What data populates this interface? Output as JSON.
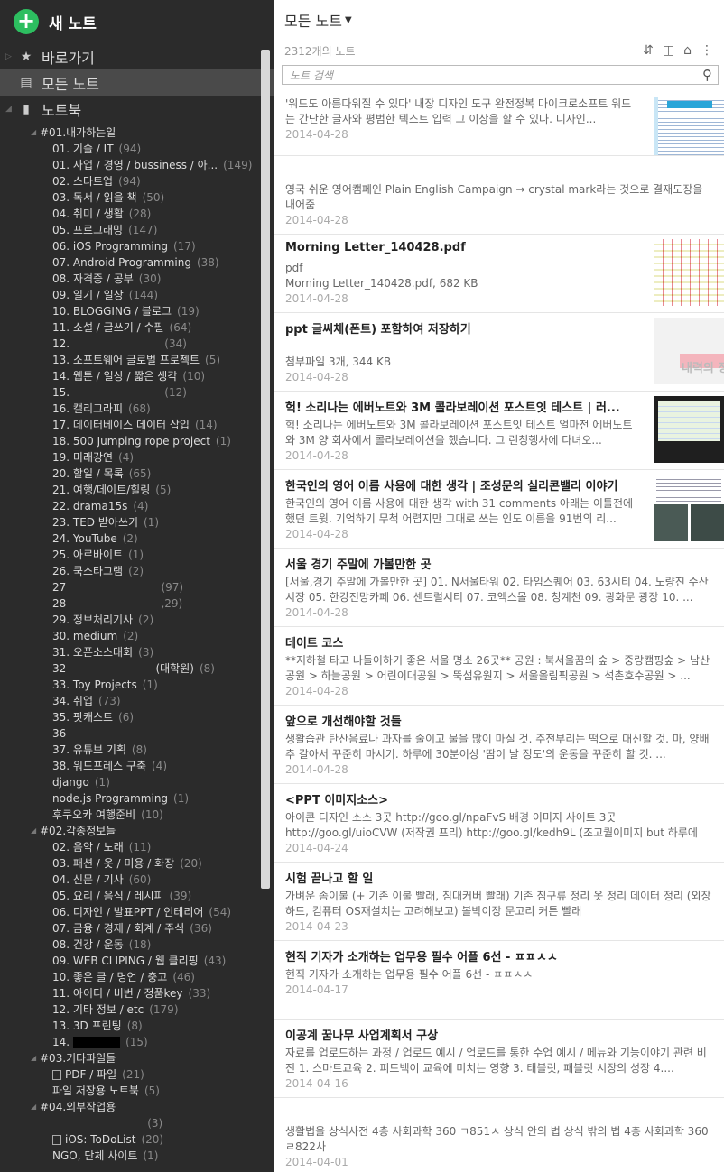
{
  "sidebar": {
    "new_note": "새 노트",
    "shortcuts": "바로가기",
    "all_notes": "모든 노트",
    "notebooks": "노트북",
    "tree": [
      {
        "kind": "stack",
        "label": "#01.내가하는일",
        "count": ""
      },
      {
        "kind": "nb",
        "label": "01. 기술 / IT",
        "count": "(94)"
      },
      {
        "kind": "nb",
        "label": "01. 사업 / 경영 / bussiness / 아...",
        "count": "(149)"
      },
      {
        "kind": "nb",
        "label": "02. 스타트업",
        "count": "(94)"
      },
      {
        "kind": "nb",
        "label": "03. 독서 / 읽을 책",
        "count": "(50)"
      },
      {
        "kind": "nb",
        "label": "04. 취미 / 생활",
        "count": "(28)"
      },
      {
        "kind": "nb",
        "label": "05. 프로그래밍",
        "count": "(147)"
      },
      {
        "kind": "nb",
        "label": "06. iOS Programming",
        "count": "(17)"
      },
      {
        "kind": "nb",
        "label": "07. Android Programming",
        "count": "(38)"
      },
      {
        "kind": "nb",
        "label": "08. 자격증 / 공부",
        "count": "(30)"
      },
      {
        "kind": "nb",
        "label": "09. 일기 / 일상",
        "count": "(144)"
      },
      {
        "kind": "nb",
        "label": "10. BLOGGING / 블로그",
        "count": "(19)"
      },
      {
        "kind": "nb",
        "label": "11. 소설 / 글쓰기 / 수필",
        "count": "(64)"
      },
      {
        "kind": "nb",
        "label": "12.                          ",
        "count": "(34)"
      },
      {
        "kind": "nb",
        "label": "13. 소프트웨어 글로벌 프로젝트",
        "count": "(5)"
      },
      {
        "kind": "nb",
        "label": "14. 웹툰 / 일상 / 짧은 생각",
        "count": "(10)"
      },
      {
        "kind": "nb",
        "label": "15.                          ",
        "count": "(12)"
      },
      {
        "kind": "nb",
        "label": "16. 캘리그라피",
        "count": "(68)"
      },
      {
        "kind": "nb",
        "label": "17. 데이터베이스 데이터 삽입",
        "count": "(14)"
      },
      {
        "kind": "nb",
        "label": "18. 500 Jumping rope project",
        "count": "(1)"
      },
      {
        "kind": "nb",
        "label": "19. 미래강연",
        "count": "(4)"
      },
      {
        "kind": "nb",
        "label": "20. 할일 / 목록",
        "count": "(65)"
      },
      {
        "kind": "nb",
        "label": "21. 여행/데이트/힐링",
        "count": "(5)"
      },
      {
        "kind": "nb",
        "label": "22. drama15s",
        "count": "(4)"
      },
      {
        "kind": "nb",
        "label": "23. TED 받아쓰기",
        "count": "(1)"
      },
      {
        "kind": "nb",
        "label": "24. YouTube",
        "count": "(2)"
      },
      {
        "kind": "nb",
        "label": "25. 아르바이트",
        "count": "(1)"
      },
      {
        "kind": "nb",
        "label": "26. 쿡스타그램",
        "count": "(2)"
      },
      {
        "kind": "nb",
        "label": "27                          ",
        "count": "(97)"
      },
      {
        "kind": "nb",
        "label": "28                          ",
        "count": ",29)"
      },
      {
        "kind": "nb",
        "label": "29. 정보처리기사",
        "count": "(2)"
      },
      {
        "kind": "nb",
        "label": "30. medium",
        "count": "(2)"
      },
      {
        "kind": "nb",
        "label": "31. 오픈소스대회",
        "count": "(3)"
      },
      {
        "kind": "nb",
        "label": "32                          (대학원)",
        "count": "(8)"
      },
      {
        "kind": "nb",
        "label": "33. Toy Projects",
        "count": "(1)"
      },
      {
        "kind": "nb",
        "label": "34. 취업",
        "count": "(73)"
      },
      {
        "kind": "nb",
        "label": "35. 팟캐스트",
        "count": "(6)"
      },
      {
        "kind": "nb",
        "label": "36",
        "count": ""
      },
      {
        "kind": "nb",
        "label": "37. 유튜브 기획",
        "count": "(8)"
      },
      {
        "kind": "nb",
        "label": "38. 워드프레스 구축",
        "count": "(4)"
      },
      {
        "kind": "nb",
        "label": "django",
        "count": "(1)"
      },
      {
        "kind": "nb",
        "label": "node.js Programming",
        "count": "(1)"
      },
      {
        "kind": "nb",
        "label": "후쿠오카 여행준비",
        "count": "(10)"
      },
      {
        "kind": "stack",
        "label": "#02.각종정보들",
        "count": ""
      },
      {
        "kind": "nb",
        "label": "02. 음악 / 노래",
        "count": "(11)"
      },
      {
        "kind": "nb",
        "label": "03. 패션 / 옷 / 미용 / 화장",
        "count": "(20)"
      },
      {
        "kind": "nb",
        "label": "04. 신문 / 기사",
        "count": "(60)"
      },
      {
        "kind": "nb",
        "label": "05. 요리 / 음식 / 레시피",
        "count": "(39)"
      },
      {
        "kind": "nb",
        "label": "06. 디자인 / 발표PPT / 인테리어",
        "count": "(54)"
      },
      {
        "kind": "nb",
        "label": "07. 금융 / 경제 / 회계 / 주식",
        "count": "(36)"
      },
      {
        "kind": "nb",
        "label": "08. 건강 / 운동",
        "count": "(18)"
      },
      {
        "kind": "nb",
        "label": "09. WEB CLIPING / 웹 클리핑",
        "count": "(43)"
      },
      {
        "kind": "nb",
        "label": "10. 좋은 글 / 명언 / 충고",
        "count": "(46)"
      },
      {
        "kind": "nb",
        "label": "11. 아이디 / 비번 / 정품key",
        "count": "(33)"
      },
      {
        "kind": "nb",
        "label": "12. 기타 정보 / etc",
        "count": "(179)"
      },
      {
        "kind": "nb",
        "label": "13. 3D 프린팅",
        "count": "(8)"
      },
      {
        "kind": "nb",
        "label": "14.",
        "count": "(15)",
        "redact": true
      },
      {
        "kind": "stack",
        "label": "#03.기타파일들",
        "count": ""
      },
      {
        "kind": "nb",
        "label": "PDF / 파일",
        "count": "(21)",
        "shared": true
      },
      {
        "kind": "nb",
        "label": "파일 저장용 노트북",
        "count": "(5)"
      },
      {
        "kind": "stack",
        "label": "#04.외부작업용",
        "count": ""
      },
      {
        "kind": "nb",
        "label": "                          ",
        "count": "(3)"
      },
      {
        "kind": "nb",
        "label": "iOS: ToDoList",
        "count": "(20)",
        "shared": true
      },
      {
        "kind": "nb",
        "label": "NGO, 단체 사이트",
        "count": "(1)"
      }
    ]
  },
  "main": {
    "title": "모든 노트",
    "count_text": "2312개의 노트",
    "search_placeholder": "노트 검색",
    "notes": [
      {
        "title": "",
        "snippet": "'워드도 아름다워질 수 있다' 내장 디자인 도구 완전정복 마이크로소프트 워드는 간단한 글자와 평범한 텍스트 입력 그 이상을 할 수 있다. 디자인...",
        "date": "2014-04-28",
        "thumb": "t1"
      },
      {
        "title": "",
        "snippet": "영국 쉬운 영어캠페인 Plain English Campaign → crystal mark라는 것으로 결재도장을 내어줌",
        "date": "2014-04-28",
        "thumb": ""
      },
      {
        "title": "Morning Letter_140428.pdf",
        "snippet": "pdf\nMorning Letter_140428.pdf,  682 KB",
        "date": "2014-04-28",
        "thumb": "t2"
      },
      {
        "title": "ppt 글씨체(폰트) 포함하여 저장하기",
        "snippet": "\n첨부파일 3개,  344 KB",
        "date": "2014-04-28",
        "thumb": "t3",
        "thumb_text": "내력의 정석"
      },
      {
        "title": "헉! 소리나는 에버노트와 3M 콜라보레이션 포스트잇 테스트 | 러...",
        "snippet": "헉! 소리나는 에버노트와 3M 콜라보레이션 포스트잇 테스트 얼마전 에버노트와 3M 양 회사에서 콜라보레이션을 했습니다. 그 런칭행사에 다녀오...",
        "date": "2014-04-28",
        "thumb": "t4"
      },
      {
        "title": "한국인의 영어 이름 사용에 대한 생각 | 조성문의 실리콘밸리 이야기",
        "snippet": "한국인의 영어 이름 사용에 대한 생각 with 31 comments 아래는 이틀전에 했던 트윗. 기억하기 무척 어렵지만 그대로 쓰는 인도 이름을 91번의 리...",
        "date": "2014-04-28",
        "thumb": "t5"
      },
      {
        "title": "서울 경기 주말에 가볼만한 곳",
        "snippet": "[서울,경기 주말에 가볼만한 곳] 01. N서울타워 02. 타임스퀘어 03. 63시티 04. 노량진 수산시장 05. 한강전망카페 06. 센트럴시티 07. 코엑스몰 08. 청계천 09. 광화문 광장 10. ...",
        "date": "2014-04-28",
        "thumb": ""
      },
      {
        "title": "데이트 코스",
        "snippet": "**지하철 타고 나들이하기 좋은 서울 명소 26곳** 공원 : 북서울꿈의 숲 > 중랑캠핑숲 > 남산공원 > 하늘공원 > 어린이대공원 > 뚝섬유원지 > 서울올림픽공원 > 석촌호수공원 > ...",
        "date": "2014-04-28",
        "thumb": ""
      },
      {
        "title": "앞으로 개선해야할 것들",
        "snippet": "생활습관 탄산음료나 과자를 줄이고 물을 많이 마실 것. 주전부리는 떡으로 대신할 것. 마, 양배추 갈아서 꾸준히 마시기. 하루에 30분이상 '땀이 날 정도'의 운동을 꾸준히 할 것. ...",
        "date": "2014-04-28",
        "thumb": ""
      },
      {
        "title": "<PPT 이미지소스>",
        "snippet": "아이콘 디자인 소스 3곳 http://goo.gl/npaFvS 배경 이미지 사이트 3곳 http://goo.gl/uioCVW (저작권 프리) http://goo.gl/kedh9L (조고퀄이미지 but 하루에 한...",
        "date": "2014-04-24",
        "thumb": ""
      },
      {
        "title": "시험 끝나고 할 일",
        "snippet": "가벼운 솜이불 (+ 기존 이불 빨래, 침대커버 빨래) 기존 침구류 정리 옷 정리 데이터 정리 (외장하드, 컴퓨터 OS재설치는 고려해보고) 볼박이장 문고리 커튼 빨래",
        "date": "2014-04-23",
        "thumb": ""
      },
      {
        "title": "현직 기자가 소개하는 업무용 필수 어플 6선 - ㅍㅍㅅㅅ",
        "snippet": "현직 기자가 소개하는 업무용 필수 어플 6선 - ㅍㅍㅅㅅ\n ",
        "date": "2014-04-17",
        "thumb": ""
      },
      {
        "title": "이공계 꿈나무 사업계획서 구상",
        "snippet": "자료를 업로드하는 과정 / 업로드 예시 / 업로드를 통한 수업 예시 / 메뉴와 기능이야기 관련 비전 1. 스마트교육 2. 피드백이 교육에 미치는 영향 3. 태블릿, 패블릿 시장의 성장 4....",
        "date": "2014-04-16",
        "thumb": ""
      },
      {
        "title": "",
        "snippet": "생활법을 상식사전 4층 사회과학 360 ㄱ851ㅅ 상식 안의 법 상식 밖의 법 4층 사회과학 360 ㄹ822사",
        "date": "2014-04-01",
        "thumb": ""
      }
    ]
  }
}
